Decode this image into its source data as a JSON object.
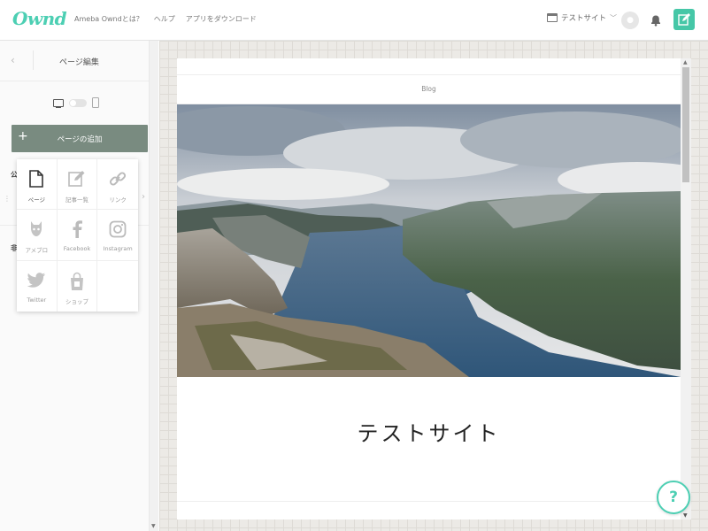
{
  "app": {
    "logo": "Ownd"
  },
  "topnav": [
    "Ameba Owndとは？",
    "ヘルプ",
    "アプリをダウンロード"
  ],
  "site_select": {
    "label": "テストサイト"
  },
  "panel": {
    "back": "‹",
    "title": "ページ編集",
    "add_page": "ページの追加",
    "side_labels": [
      "公",
      "非"
    ]
  },
  "popup": {
    "items": [
      {
        "label": "ページ",
        "icon": "page-icon"
      },
      {
        "label": "記事一覧",
        "icon": "article-list-icon"
      },
      {
        "label": "リンク",
        "icon": "link-icon"
      },
      {
        "label": "アメブロ",
        "icon": "ameblo-icon"
      },
      {
        "label": "Facebook",
        "icon": "facebook-icon"
      },
      {
        "label": "Instagram",
        "icon": "instagram-icon"
      },
      {
        "label": "Twitter",
        "icon": "twitter-icon"
      },
      {
        "label": "ショップ",
        "icon": "shop-icon"
      }
    ]
  },
  "preview": {
    "nav_label": "Blog",
    "site_title": "テストサイト"
  },
  "help": {
    "label": "?"
  },
  "colors": {
    "accent": "#4ccfb3",
    "add_button": "#798b80",
    "edit_button": "#46c7a7"
  }
}
